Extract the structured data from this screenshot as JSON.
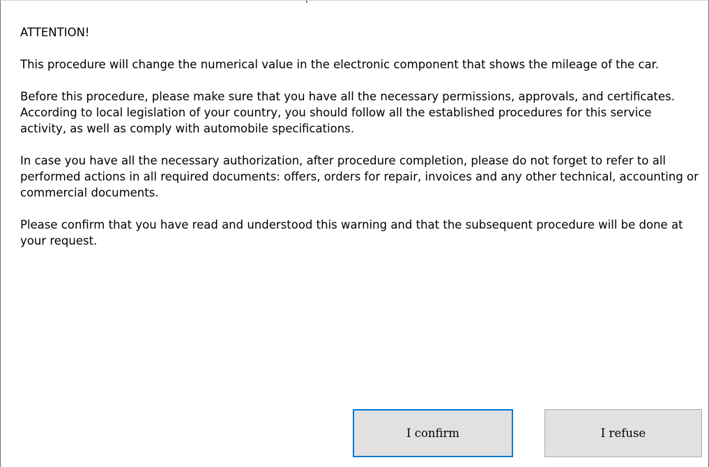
{
  "dialog": {
    "heading": "ATTENTION!",
    "paragraphs": [
      "This procedure will change the numerical value in the electronic component that shows the mileage of the car.",
      "Before this procedure, please make sure that you have all the necessary permissions, approvals, and certificates. According to local legislation of your country, you should follow all the established procedures for this service activity, as well as comply with automobile specifications.",
      "In case you have all the necessary authorization, after procedure completion, please do not forget to refer to all performed actions in all required documents: offers, orders for repair, invoices and any other technical, accounting or commercial documents.",
      "Please confirm that you have read and understood this warning and that the subsequent procedure will be done at your request."
    ],
    "buttons": {
      "confirm_label": "I confirm",
      "refuse_label": "I refuse"
    }
  },
  "colors": {
    "focus_border": "#0078d7",
    "button_face": "#e1e1e1",
    "button_border": "#adadad"
  }
}
